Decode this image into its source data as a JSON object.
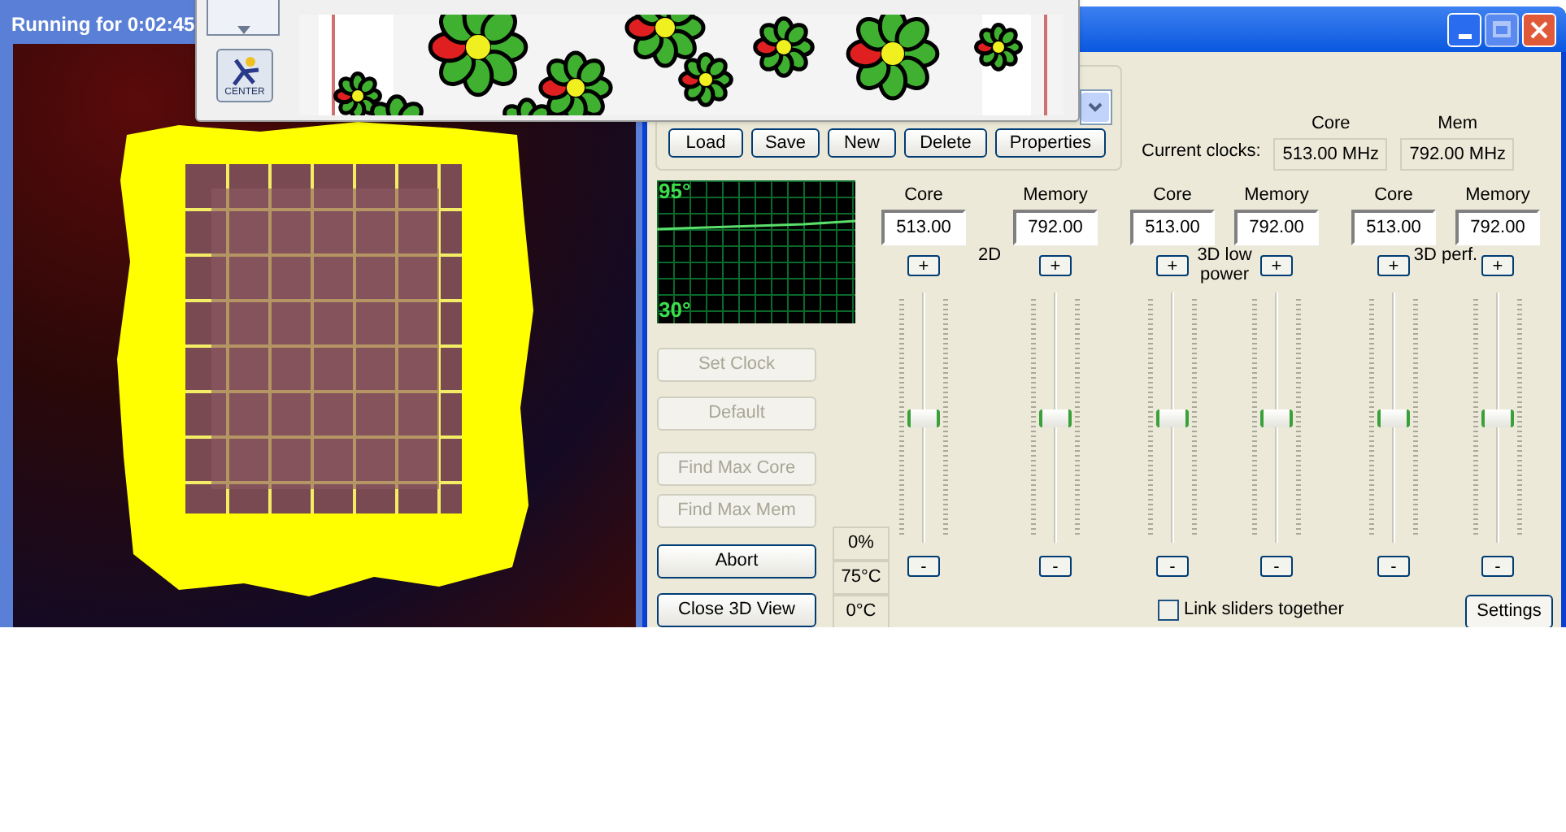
{
  "view_window": {
    "title": "Running for 0:02:45"
  },
  "icq_window": {
    "center_button": "CENTER"
  },
  "main_window": {
    "profile_buttons": [
      "Load",
      "Save",
      "New",
      "Delete",
      "Properties"
    ],
    "current_clocks": {
      "label": "Current clocks:",
      "columns": [
        {
          "header": "Core",
          "value": "513.00 MHz"
        },
        {
          "header": "Mem",
          "value": "792.00 MHz"
        }
      ]
    },
    "temperature_graph": {
      "top_label": "95°",
      "bottom_label": "30°"
    },
    "actions": [
      {
        "label": "Set Clock",
        "disabled": true
      },
      {
        "label": "Default",
        "disabled": true
      },
      {
        "label": "Find Max Core",
        "disabled": true
      },
      {
        "label": "Find Max Mem",
        "disabled": true
      },
      {
        "label": "Abort",
        "disabled": false
      },
      {
        "label": "Close 3D View",
        "disabled": false
      }
    ],
    "status": [
      "0%",
      "75°C",
      "0°C"
    ],
    "groups": [
      {
        "label": "2D",
        "sliders": [
          {
            "header": "Core",
            "value": "513.00",
            "plus": "+",
            "minus": "-",
            "level": 0.5
          },
          {
            "header": "Memory",
            "value": "792.00",
            "plus": "+",
            "minus": "-",
            "level": 0.5
          }
        ]
      },
      {
        "label": "3D low power",
        "sliders": [
          {
            "header": "Core",
            "value": "513.00",
            "plus": "+",
            "minus": "-",
            "level": 0.5
          },
          {
            "header": "Memory",
            "value": "792.00",
            "plus": "+",
            "minus": "-",
            "level": 0.5
          }
        ]
      },
      {
        "label": "3D perf.",
        "sliders": [
          {
            "header": "Core",
            "value": "513.00",
            "plus": "+",
            "minus": "-",
            "level": 0.5
          },
          {
            "header": "Memory",
            "value": "792.00",
            "plus": "+",
            "minus": "-",
            "level": 0.5
          }
        ]
      }
    ],
    "link_sliders": {
      "label": "Link sliders together",
      "checked": false
    },
    "settings_button": "Settings"
  }
}
